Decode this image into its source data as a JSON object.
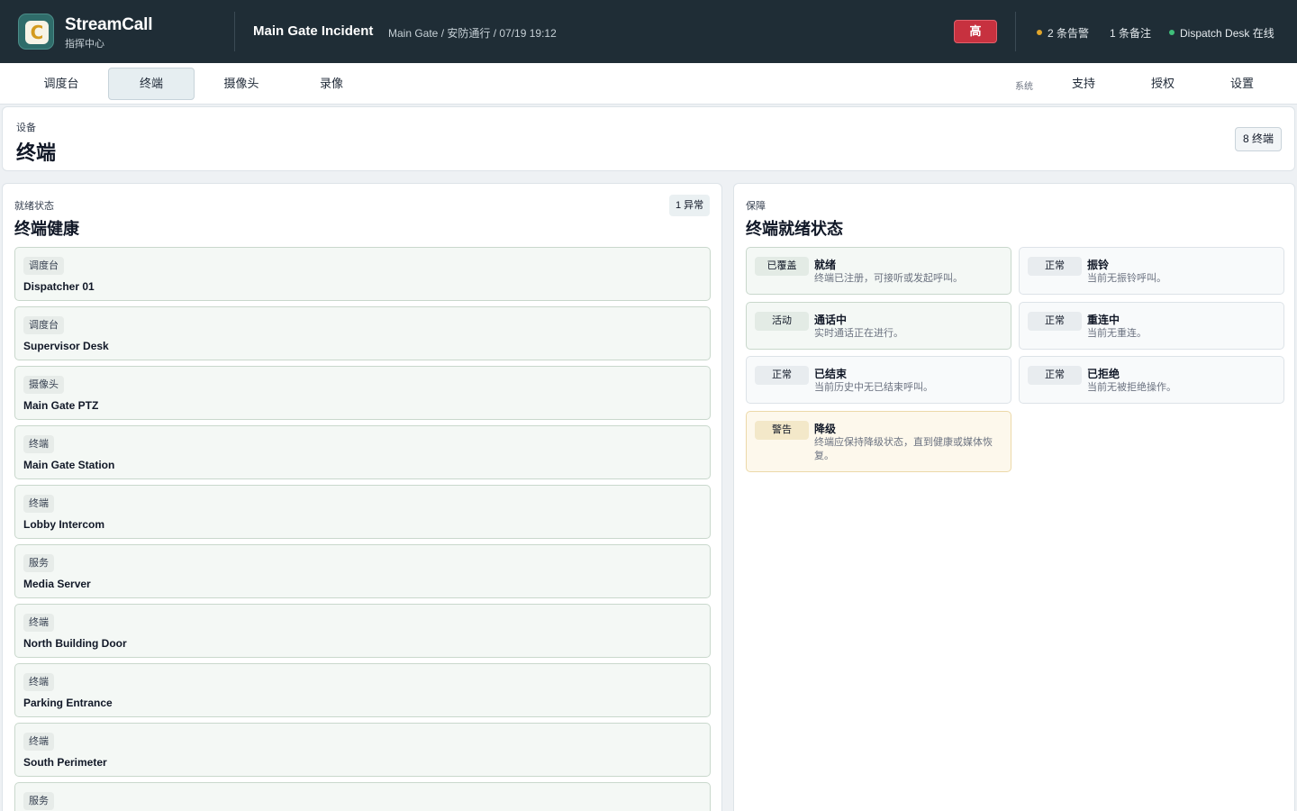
{
  "header": {
    "brand_glyph": "C",
    "brand_name": "StreamCall",
    "brand_sub": "指挥中心",
    "incident_title": "Main Gate Incident",
    "incident_meta": "Main Gate / 安防通行 / 07/19 19:12",
    "priority_label": "高",
    "alerts": "2 条告警",
    "notes": "1 条备注",
    "desk_status": "Dispatch Desk 在线",
    "colors": {
      "bg": "#1f2d36",
      "priority": "#c7313f",
      "alert_dot": "#e0a52b",
      "online_dot": "#3fbf7a"
    }
  },
  "nav": {
    "tabs": [
      {
        "label": "调度台",
        "active": false
      },
      {
        "label": "终端",
        "active": true
      },
      {
        "label": "摄像头",
        "active": false
      },
      {
        "label": "录像",
        "active": false
      }
    ],
    "system_label": "系统",
    "right_items": [
      "支持",
      "授权",
      "设置"
    ]
  },
  "page": {
    "eyebrow": "设备",
    "title": "终端",
    "count": "8 终端"
  },
  "health": {
    "eyebrow": "就绪状态",
    "title": "终端健康",
    "badge": "1 异常",
    "endpoints": [
      {
        "type": "调度台",
        "name": "Dispatcher 01"
      },
      {
        "type": "调度台",
        "name": "Supervisor Desk"
      },
      {
        "type": "摄像头",
        "name": "Main Gate PTZ"
      },
      {
        "type": "终端",
        "name": "Main Gate Station"
      },
      {
        "type": "终端",
        "name": "Lobby Intercom"
      },
      {
        "type": "服务",
        "name": "Media Server"
      },
      {
        "type": "终端",
        "name": "North Building Door"
      },
      {
        "type": "终端",
        "name": "Parking Entrance"
      },
      {
        "type": "终端",
        "name": "South Perimeter"
      },
      {
        "type": "服务",
        "name": ""
      }
    ]
  },
  "readiness": {
    "eyebrow": "保障",
    "title": "终端就绪状态",
    "states": [
      {
        "tag": "已覆盖",
        "title": "就绪",
        "desc": "终端已注册，可接听或发起呼叫。",
        "tone": "green"
      },
      {
        "tag": "正常",
        "title": "振铃",
        "desc": "当前无振铃呼叫。",
        "tone": "neutral"
      },
      {
        "tag": "活动",
        "title": "通话中",
        "desc": "实时通话正在进行。",
        "tone": "green"
      },
      {
        "tag": "正常",
        "title": "重连中",
        "desc": "当前无重连。",
        "tone": "neutral"
      },
      {
        "tag": "正常",
        "title": "已结束",
        "desc": "当前历史中无已结束呼叫。",
        "tone": "neutral"
      },
      {
        "tag": "正常",
        "title": "已拒绝",
        "desc": "当前无被拒绝操作。",
        "tone": "neutral"
      },
      {
        "tag": "警告",
        "title": "降级",
        "desc": "终端应保持降级状态，直到健康或媒体恢复。",
        "tone": "amber"
      }
    ]
  }
}
